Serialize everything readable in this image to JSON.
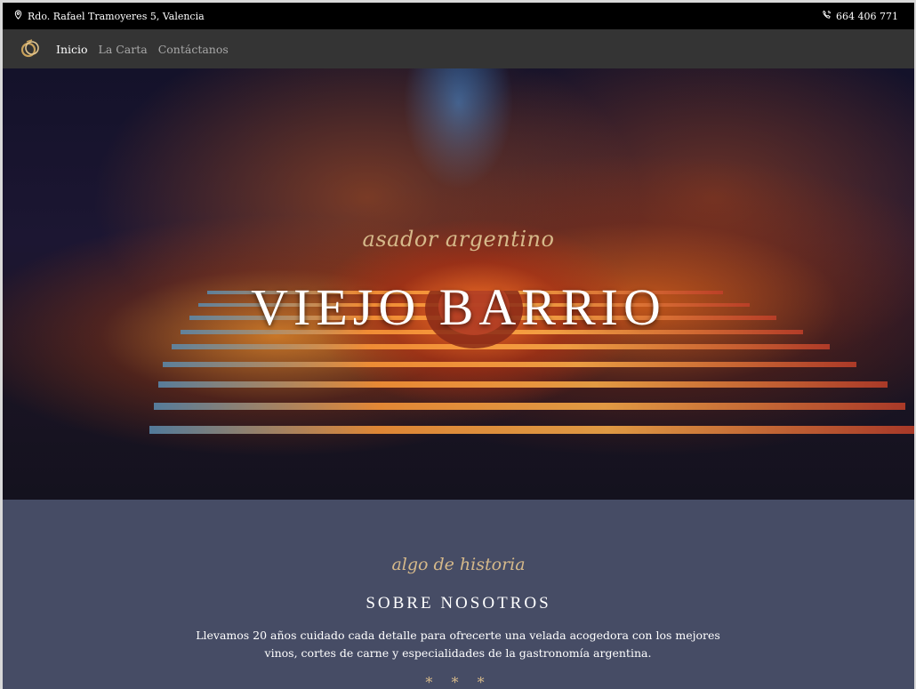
{
  "topbar": {
    "address": "Rdo. Rafael Tramoyeres 5, Valencia",
    "phone": "664 406 771",
    "address_icon": "map-pin-icon",
    "phone_icon": "phone-icon"
  },
  "nav": {
    "logo_icon": "restaurant-logo",
    "items": [
      {
        "label": "Inicio",
        "active": true
      },
      {
        "label": "La Carta",
        "active": false
      },
      {
        "label": "Contáctanos",
        "active": false
      }
    ]
  },
  "hero": {
    "subtitle": "asador argentino",
    "title": "VIEJO BARRIO"
  },
  "about": {
    "subtitle": "algo de historia",
    "title": "SOBRE NOSOTROS",
    "text": "Llevamos 20 años cuidado cada detalle para ofrecerte una velada acogedora con los mejores vinos, cortes de carne y especialidades de la gastronomía argentina.",
    "divider": "* * *"
  },
  "colors": {
    "accent": "#d6b98a",
    "nav_bg": "#343434",
    "about_bg": "#464c65"
  }
}
